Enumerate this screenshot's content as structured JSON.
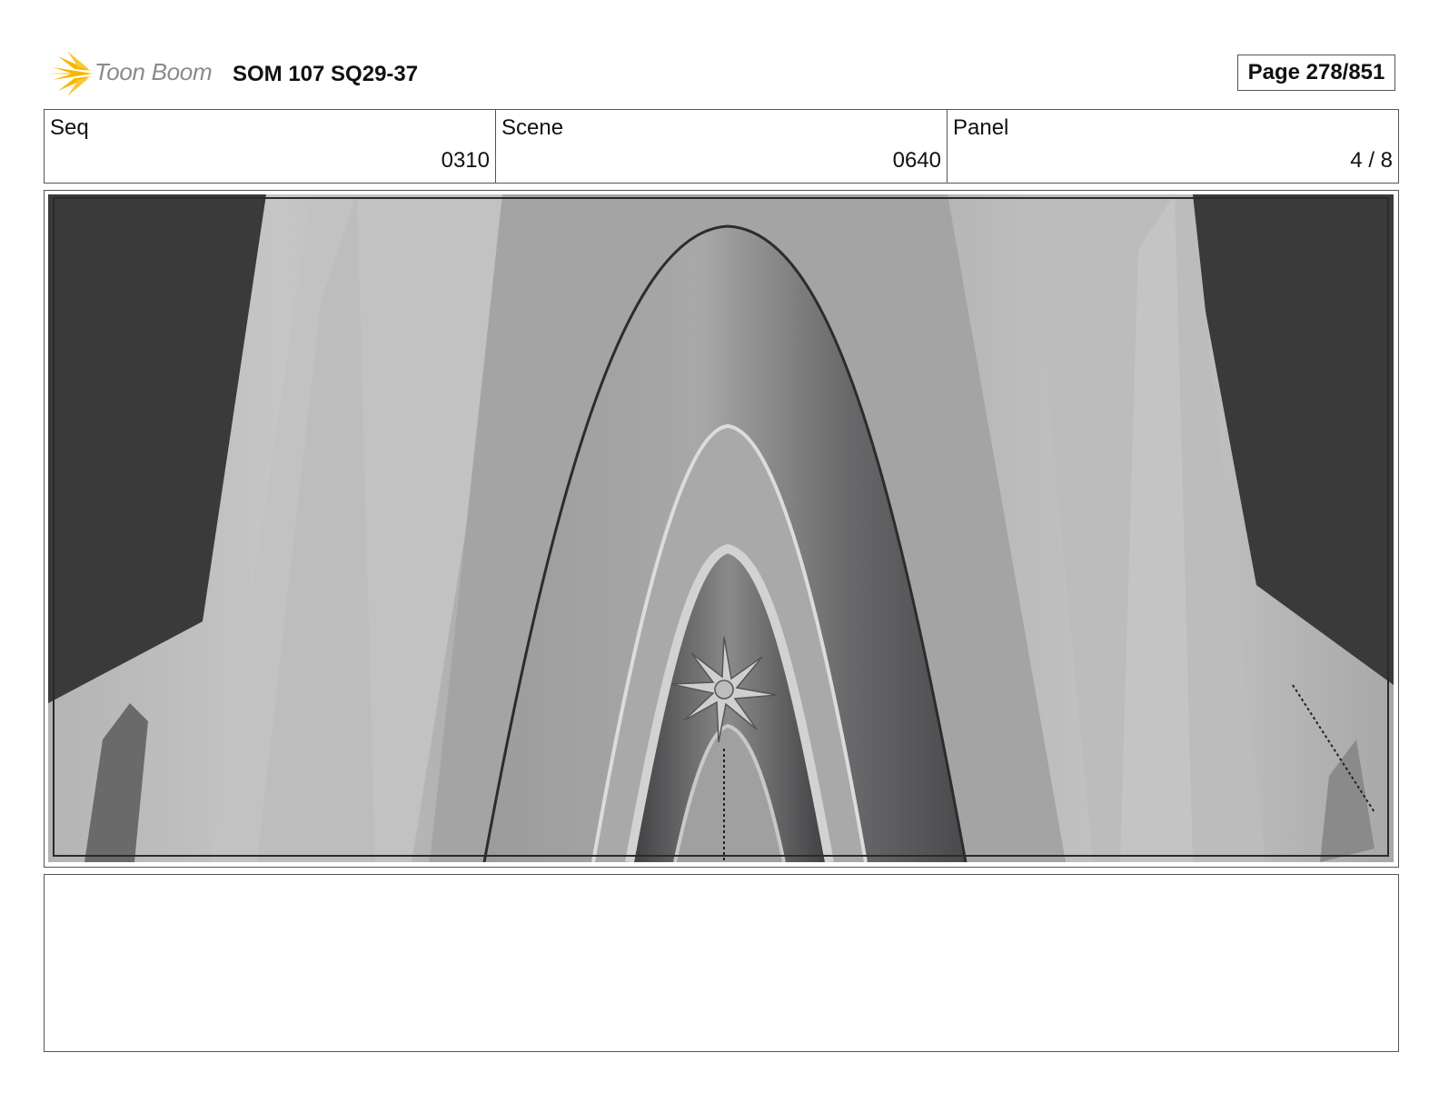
{
  "header": {
    "logo_text": "Toon Boom",
    "title": "SOM 107 SQ29-37",
    "page_label": "Page 278/851"
  },
  "info": {
    "seq_label": "Seq",
    "seq_value": "0310",
    "scene_label": "Scene",
    "scene_value": "0640",
    "panel_label": "Panel",
    "panel_value": "4 / 8"
  },
  "colors": {
    "logo_accent": "#F5B800",
    "background_dark": "#3a3a3a"
  },
  "notes": {
    "text": ""
  }
}
